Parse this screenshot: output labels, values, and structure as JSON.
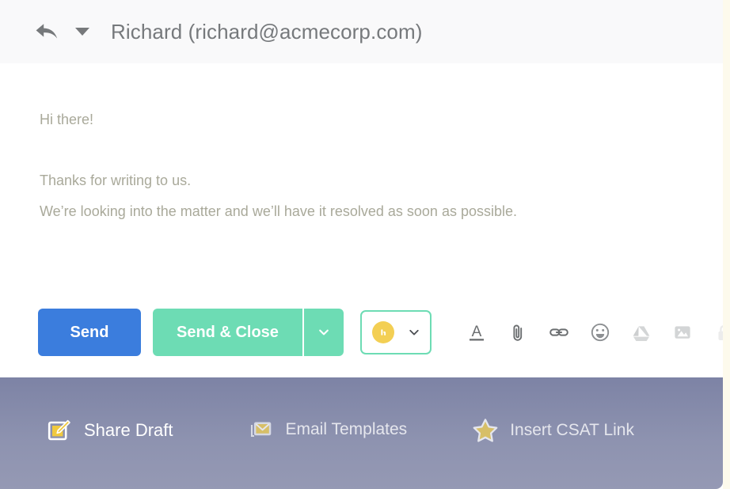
{
  "header": {
    "reply_icon": "reply-arrow-icon",
    "caret_icon": "chevron-down-icon",
    "recipient": "Richard (richard@acmecorp.com)"
  },
  "mail_body": {
    "greeting": "Hi there!",
    "line1": "Thanks for writing to us.",
    "line2": "We’re looking into the matter and we’ll have it resolved as soon as possible."
  },
  "actions": {
    "send_label": "Send",
    "send_close_label": "Send & Close",
    "send_close_caret": "chevron-down-icon",
    "snippet_avatar": "avatar-badge-icon",
    "snippet_caret": "chevron-down-icon",
    "tools": [
      {
        "name": "text-format-icon"
      },
      {
        "name": "attachment-icon"
      },
      {
        "name": "link-icon"
      },
      {
        "name": "emoji-icon"
      },
      {
        "name": "google-drive-icon"
      },
      {
        "name": "image-icon"
      },
      {
        "name": "lock-icon"
      }
    ]
  },
  "bottom_bar": {
    "items": [
      {
        "label": "Share Draft",
        "icon": "memo-pencil-icon"
      },
      {
        "label": "Email Templates",
        "icon": "envelope-icon"
      },
      {
        "label": "Insert CSAT Link",
        "icon": "star-icon"
      }
    ]
  },
  "colors": {
    "send_blue": "#3b7ddd",
    "send_close_green": "#6ddcb4",
    "badge_yellow": "#f3cf54",
    "bottom_bar_purple": "#8e93b0",
    "body_text": "#a9a99a",
    "header_bg": "#f9f9fa",
    "right_strip": "#fdfaec"
  }
}
